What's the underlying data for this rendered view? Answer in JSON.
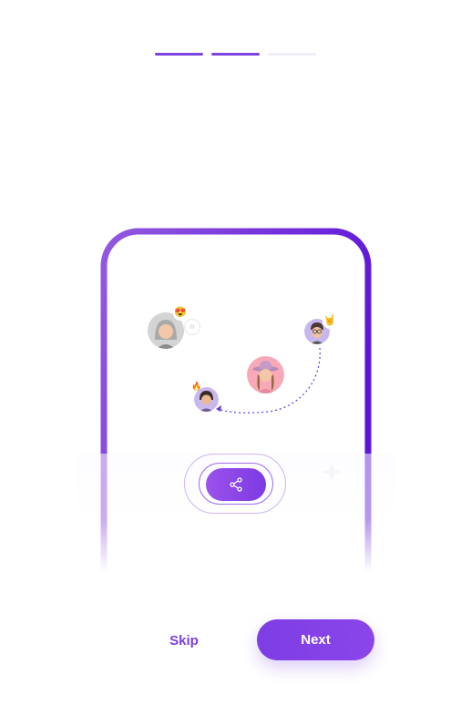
{
  "progress": {
    "total_steps": 3,
    "current_step": 2
  },
  "illustration": {
    "avatars": [
      {
        "name": "grey-haired-memoji",
        "reactions": [
          "heart-eyes-emoji",
          "thought-bubble-icon"
        ]
      },
      {
        "name": "cowgirl-memoji",
        "reactions": []
      },
      {
        "name": "glasses-memoji",
        "reactions": [
          "rock-on-hand-emoji"
        ]
      },
      {
        "name": "small-memoji",
        "reactions": [
          "fire-emoji"
        ]
      }
    ],
    "share_icon": "share-icon"
  },
  "actions": {
    "skip_label": "Skip",
    "next_label": "Next"
  },
  "colors": {
    "accent": "#7b45e0",
    "accent_light": "#9b52ec",
    "inactive": "#f1eff6"
  }
}
